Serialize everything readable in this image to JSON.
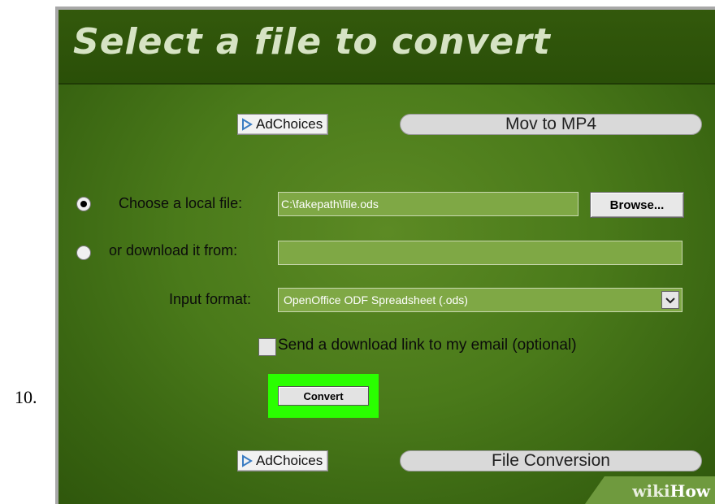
{
  "step_number": "10.",
  "header": {
    "title": "Select a file to convert"
  },
  "ads": {
    "top": {
      "adchoices_label": "AdChoices",
      "link_label": "Mov to MP4"
    },
    "bottom": {
      "adchoices_label": "AdChoices",
      "link_label": "File Conversion"
    }
  },
  "form": {
    "local_file": {
      "label": "Choose a local file:",
      "value": "C:\\fakepath\\file.ods",
      "selected": true
    },
    "browse_label": "Browse...",
    "download_from": {
      "label": "or download it from:",
      "value": "",
      "selected": false
    },
    "input_format": {
      "label": "Input format:",
      "selected_value": "OpenOffice ODF Spreadsheet (.ods)"
    },
    "email_option": {
      "label": "Send a download link to my email (optional)",
      "checked": false
    },
    "convert_label": "Convert"
  },
  "watermark": {
    "wiki": "wiki",
    "how": "How"
  },
  "colors": {
    "highlight": "#2aff00",
    "background": "#4a7a1a",
    "field": "#7fa845"
  }
}
